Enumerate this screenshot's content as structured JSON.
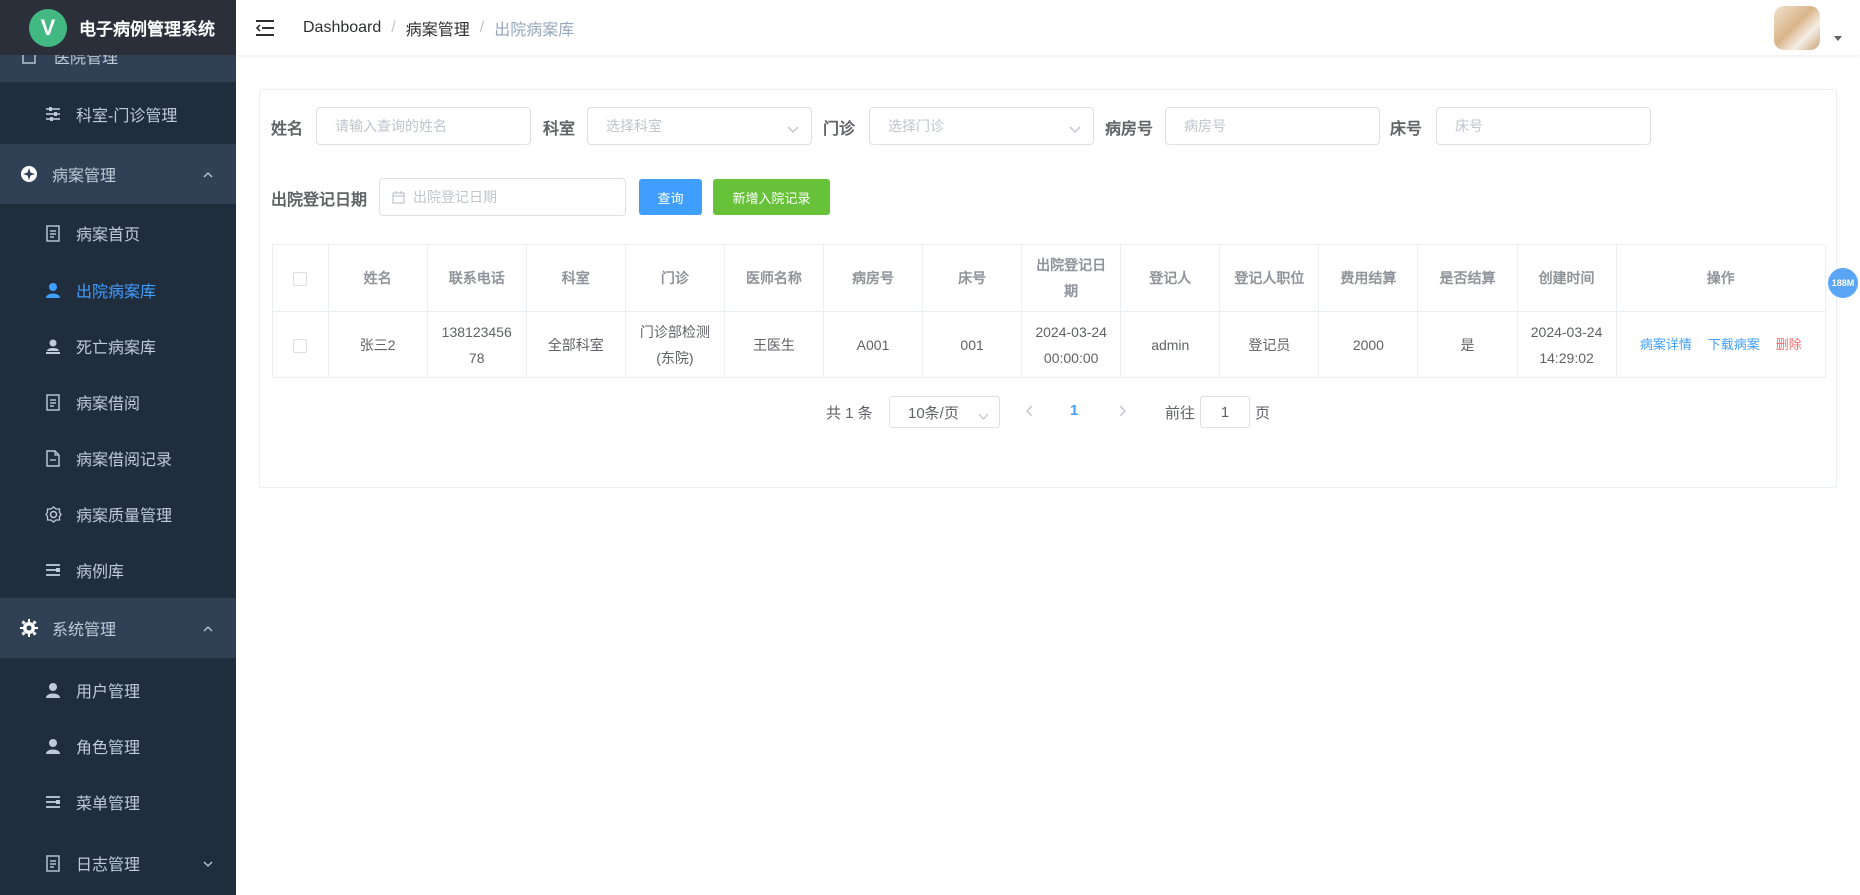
{
  "app": {
    "title": "电子病例管理系统",
    "logo_letter": "V"
  },
  "sidebar": {
    "partial_item": "医院管理",
    "items": [
      {
        "label": "科室-门诊管理",
        "icon": "sliders-icon"
      },
      {
        "label": "病案管理",
        "icon": "compass-icon"
      },
      {
        "label": "病案首页",
        "icon": "document-icon"
      },
      {
        "label": "出院病案库",
        "icon": "user-icon"
      },
      {
        "label": "死亡病案库",
        "icon": "user-bust-icon"
      },
      {
        "label": "病案借阅",
        "icon": "document-icon"
      },
      {
        "label": "病案借阅记录",
        "icon": "file-icon"
      },
      {
        "label": "病案质量管理",
        "icon": "gear-icon"
      },
      {
        "label": "病例库",
        "icon": "list-icon"
      },
      {
        "label": "系统管理",
        "icon": "settings-icon"
      },
      {
        "label": "用户管理",
        "icon": "user-icon"
      },
      {
        "label": "角色管理",
        "icon": "user-icon"
      },
      {
        "label": "菜单管理",
        "icon": "list-icon"
      },
      {
        "label": "日志管理",
        "icon": "document-icon"
      }
    ]
  },
  "breadcrumb": [
    "Dashboard",
    "病案管理",
    "出院病案库"
  ],
  "filters": {
    "name_label": "姓名",
    "name_placeholder": "请输入查询的姓名",
    "dept_label": "科室",
    "dept_placeholder": "选择科室",
    "clinic_label": "门诊",
    "clinic_placeholder": "选择门诊",
    "ward_label": "病房号",
    "ward_placeholder": "病房号",
    "bed_label": "床号",
    "bed_placeholder": "床号",
    "date_label": "出院登记日期",
    "date_placeholder": "出院登记日期",
    "query_button": "查询",
    "add_button": "新增入院记录"
  },
  "table": {
    "headers": [
      "姓名",
      "联系电话",
      "科室",
      "门诊",
      "医师名称",
      "病房号",
      "床号",
      "出院登记日期",
      "登记人",
      "登记人职位",
      "费用结算",
      "是否结算",
      "创建时间",
      "操作"
    ],
    "rows": [
      {
        "name": "张三2",
        "phone": "13812345678",
        "dept": "全部科室",
        "clinic": "门诊部检测(东院)",
        "doctor": "王医生",
        "ward": "A001",
        "bed": "001",
        "discharge_date": "2024-03-24 00:00:00",
        "registrar": "admin",
        "registrar_title": "登记员",
        "fee": "2000",
        "settled": "是",
        "created": "2024-03-24 14:29:02",
        "actions": {
          "detail": "病案详情",
          "download": "下载病案",
          "delete": "删除"
        }
      }
    ]
  },
  "pagination": {
    "total": "共 1 条",
    "page_size": "10条/页",
    "current_page": "1",
    "goto_label": "前往",
    "goto_value": "1",
    "page_suffix": "页"
  },
  "memory_badge": "188M",
  "colors": {
    "sidebar": "#304156",
    "accent": "#409eff",
    "success": "#67c23a",
    "danger": "#f56c6c"
  }
}
